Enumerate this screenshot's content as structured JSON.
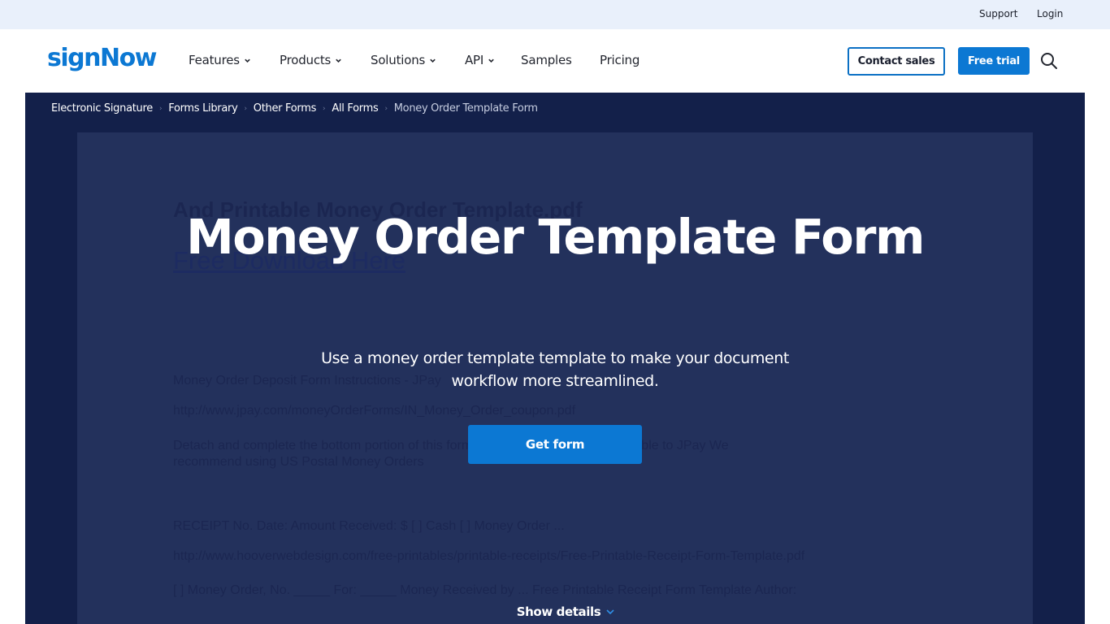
{
  "topbar": {
    "support": "Support",
    "login": "Login"
  },
  "brand": {
    "logo": "signNow",
    "accent": "#0c78d3",
    "hero_bg": "#13204a",
    "panel_bg": "#23315c"
  },
  "nav": {
    "items": [
      {
        "label": "Features",
        "dropdown": true
      },
      {
        "label": "Products",
        "dropdown": true
      },
      {
        "label": "Solutions",
        "dropdown": true
      },
      {
        "label": "API",
        "dropdown": true
      },
      {
        "label": "Samples",
        "dropdown": false
      },
      {
        "label": "Pricing",
        "dropdown": false
      }
    ],
    "contact_sales": "Contact sales",
    "free_trial": "Free trial",
    "search_icon": "search-icon"
  },
  "breadcrumb": {
    "items": [
      "Electronic Signature",
      "Forms Library",
      "Other Forms",
      "All Forms"
    ],
    "current": "Money Order Template Form"
  },
  "hero": {
    "title": "Money Order Template Form",
    "subtitle": "Use a money order template template to make your document workflow more streamlined.",
    "cta": "Get form",
    "show_details": "Show details"
  },
  "document_preview": {
    "heading": "And Printable Money Order Template.pdf",
    "link": "Free Download Here",
    "lines": [
      "Money Order Deposit Form Instructions - JPay",
      "http://www.jpay.com/moneyOrderForms/IN_Money_Order_coupon.pdf",
      "Detach and complete the bottom portion of this form. Make the money order payable to JPay We",
      "recommend using US Postal Money Orders",
      "RECEIPT No. Date: Amount Received: $ [ ] Cash [ ] Money Order ...",
      "http://www.hooverwebdesign.com/free-printables/printable-receipts/Free-Printable-Receipt-Form-Template.pdf",
      "[ ] Money Order, No. _____ For: _____ Money Received by ... Free Printable Receipt Form Template Author:"
    ]
  }
}
